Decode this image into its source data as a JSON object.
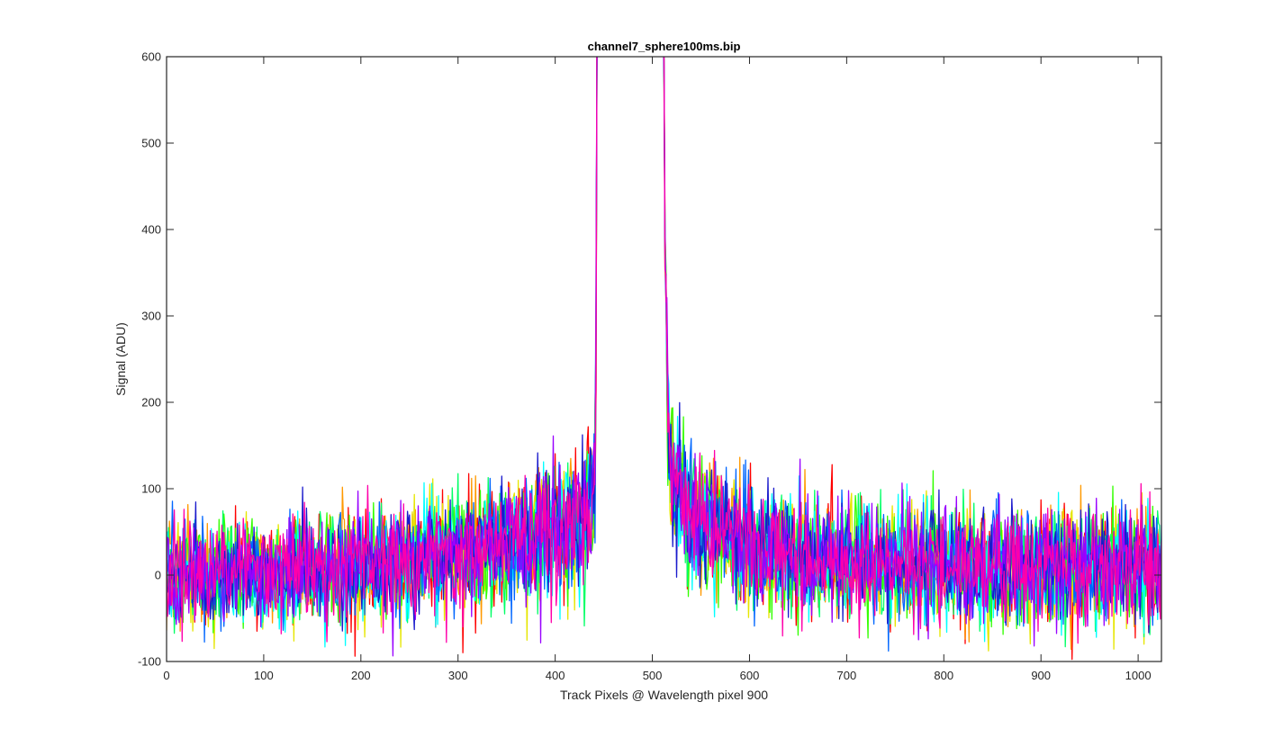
{
  "chart_data": {
    "type": "line",
    "title": "channel7_sphere100ms.bip",
    "xlabel": "Track Pixels @ Wavelength pixel 900",
    "ylabel": "Signal (ADU)",
    "xlim": [
      0,
      1024
    ],
    "ylim": [
      -100,
      600
    ],
    "xticks": [
      0,
      100,
      200,
      300,
      400,
      500,
      600,
      700,
      800,
      900,
      1000
    ],
    "yticks": [
      -100,
      0,
      100,
      200,
      300,
      400,
      500,
      600
    ],
    "grid": false,
    "legend": "none",
    "series_colors": [
      "#ff0000",
      "#ff9900",
      "#e6e600",
      "#33ff00",
      "#00ff66",
      "#00ffff",
      "#0066ff",
      "#1a1acc",
      "#9900ff",
      "#ff00aa"
    ],
    "profile": {
      "note_x": [
        0,
        100,
        200,
        300,
        380,
        420,
        435,
        441,
        442,
        443,
        510,
        512,
        513,
        516,
        520,
        540,
        600,
        700,
        800,
        900,
        1024
      ],
      "baseline": [
        0,
        5,
        10,
        25,
        45,
        60,
        75,
        110,
        250,
        600,
        600,
        600,
        380,
        180,
        120,
        70,
        35,
        15,
        10,
        10,
        10
      ],
      "noise_sd": [
        28,
        28,
        30,
        32,
        35,
        40,
        45,
        45,
        45,
        45,
        45,
        45,
        40,
        40,
        40,
        38,
        35,
        32,
        32,
        32,
        32
      ]
    },
    "features": {
      "saturated_peak_range": [
        443,
        512
      ],
      "gap_range": [
        443,
        512
      ]
    }
  }
}
